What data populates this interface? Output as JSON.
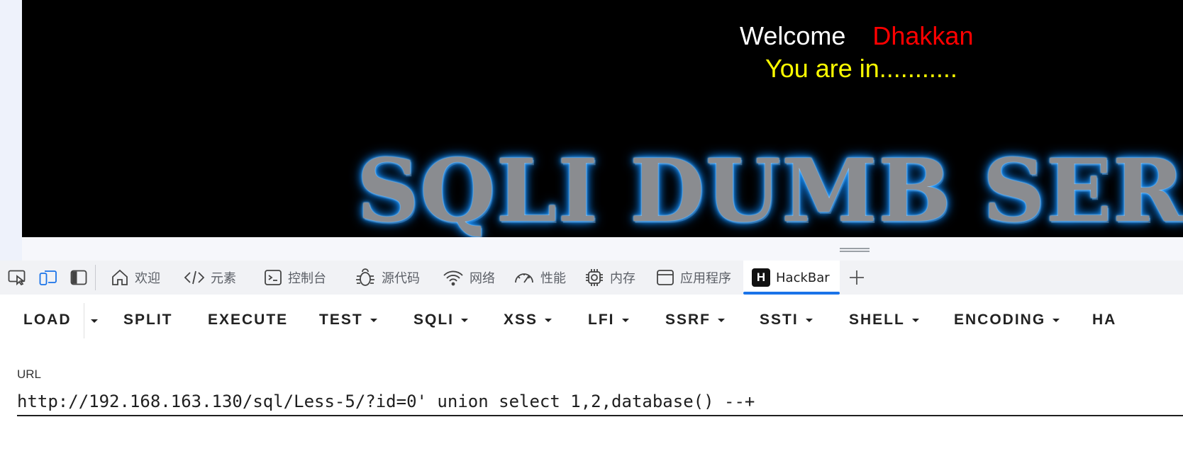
{
  "page": {
    "welcome_text": "Welcome",
    "username": "Dhakkan",
    "status_text": "You are in...........",
    "banner_text": "SQLI DUMB SERIES"
  },
  "devtools": {
    "tabs": [
      {
        "label": "欢迎",
        "icon": "home-icon"
      },
      {
        "label": "元素",
        "icon": "code-icon"
      },
      {
        "label": "控制台",
        "icon": "console-icon"
      },
      {
        "label": "源代码",
        "icon": "bug-icon"
      },
      {
        "label": "网络",
        "icon": "wifi-icon"
      },
      {
        "label": "性能",
        "icon": "gauge-icon"
      },
      {
        "label": "内存",
        "icon": "chip-icon"
      },
      {
        "label": "应用程序",
        "icon": "app-window-icon"
      },
      {
        "label": "HackBar",
        "icon": "hackbar-logo-icon",
        "logo_letter": "H",
        "active": true
      }
    ],
    "colors": {
      "active_tab_underline": "#1a73e8"
    }
  },
  "hackbar": {
    "buttons": [
      {
        "label": "LOAD"
      },
      {
        "label": "SPLIT"
      },
      {
        "label": "EXECUTE"
      },
      {
        "label": "TEST"
      },
      {
        "label": "SQLI"
      },
      {
        "label": "XSS"
      },
      {
        "label": "LFI"
      },
      {
        "label": "SSRF"
      },
      {
        "label": "SSTI"
      },
      {
        "label": "SHELL"
      },
      {
        "label": "ENCODING"
      },
      {
        "label": "HA"
      }
    ],
    "url_label": "URL",
    "url_value": "http://192.168.163.130/sql/Less-5/?id=0' union select 1,2,database() --+"
  }
}
